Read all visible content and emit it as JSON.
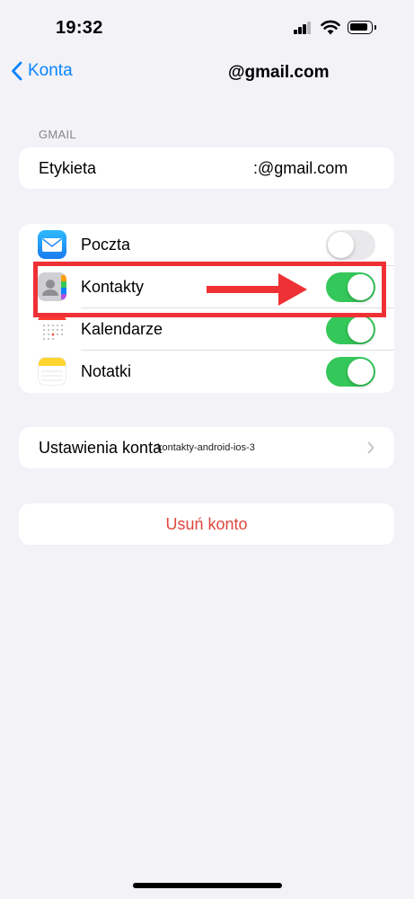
{
  "status_bar": {
    "time": "19:32"
  },
  "nav": {
    "back_label": "Konta",
    "title": "@gmail.com"
  },
  "account_section": {
    "header": "GMAIL",
    "label_title": "Etykieta",
    "label_value": ":@gmail.com"
  },
  "services": [
    {
      "label": "Poczta",
      "enabled": false,
      "icon": "mail-icon"
    },
    {
      "label": "Kontakty",
      "enabled": true,
      "icon": "contacts-icon"
    },
    {
      "label": "Kalendarze",
      "enabled": true,
      "icon": "calendar-icon"
    },
    {
      "label": "Notatki",
      "enabled": true,
      "icon": "notes-icon"
    }
  ],
  "account_settings": {
    "label": "Ustawienia konta",
    "overlay_text": "kontakty-android-ios-3"
  },
  "delete_account": {
    "label": "Usuń konto"
  },
  "colors": {
    "accent_blue": "#0a84ff",
    "toggle_green": "#34c759",
    "destructive_red": "#e0463c",
    "highlight_red": "#ef3136"
  }
}
